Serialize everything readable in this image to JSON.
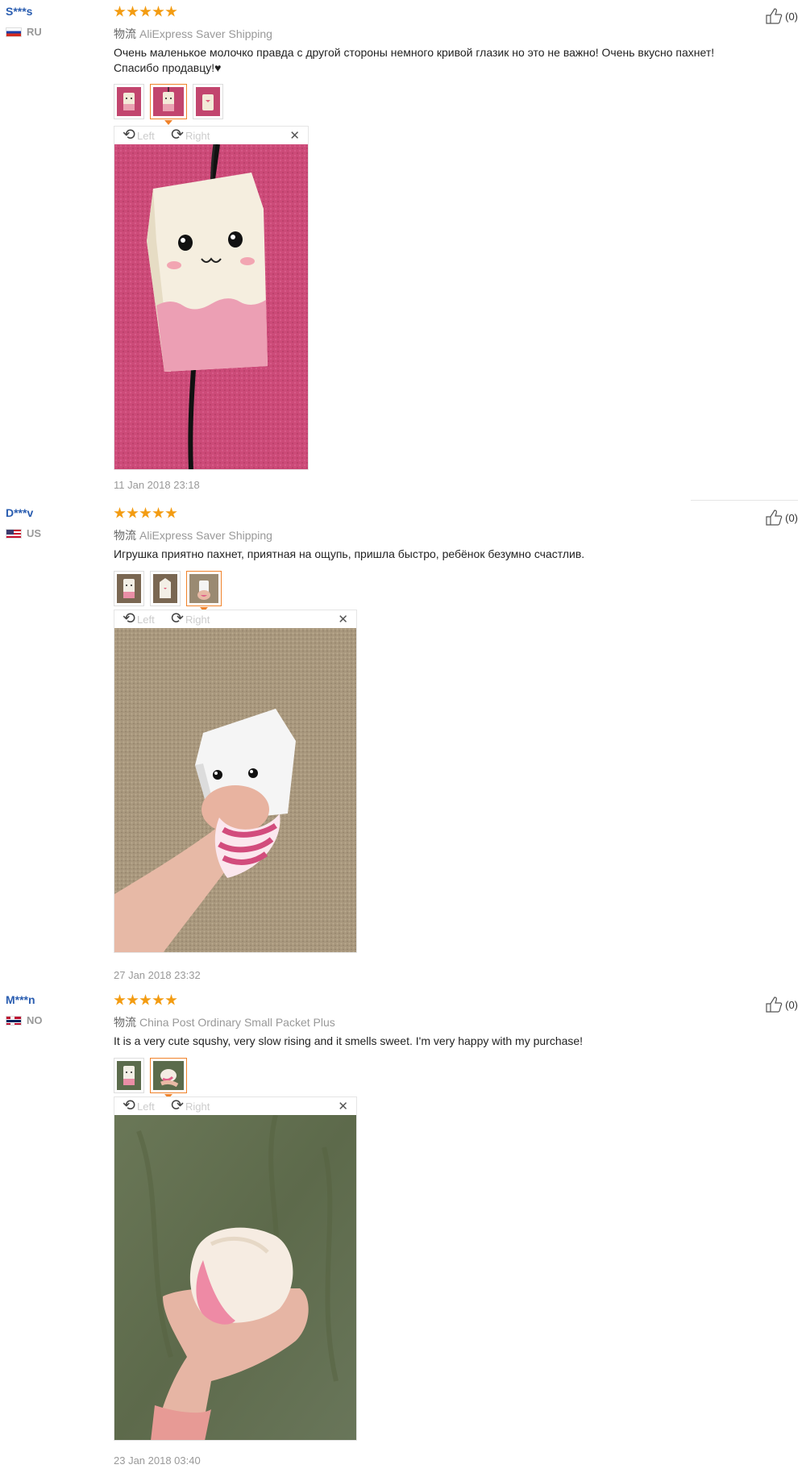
{
  "reviews": [
    {
      "user": "S***s",
      "country": "RU",
      "shipping_label": "物流",
      "shipping": "AliExpress Saver Shipping",
      "text_lines": [
        "Очень маленькое молочко правда с другой стороны немного кривой глазик но это не важно! Очень вкусно пахнет!",
        "Спасибо продавцу!♥"
      ],
      "rotate_left": "Left",
      "rotate_right": "Right",
      "date": "11 Jan 2018 23:18",
      "helpful": "(0)",
      "rating": 5
    },
    {
      "user": "D***v",
      "country": "US",
      "shipping_label": "物流",
      "shipping": "AliExpress Saver Shipping",
      "text_lines": [
        "Игрушка приятно пахнет, приятная на ощупь, пришла быстро, ребёнок безумно счастлив."
      ],
      "rotate_left": "Left",
      "rotate_right": "Right",
      "date": "27 Jan 2018 23:32",
      "helpful": "(0)",
      "rating": 5
    },
    {
      "user": "M***n",
      "country": "NO",
      "shipping_label": "物流",
      "shipping": "China Post Ordinary Small Packet Plus",
      "text_lines": [
        "It is a very cute squshy, very slow rising and it smells sweet. I'm very happy with my purchase!"
      ],
      "rotate_left": "Left",
      "rotate_right": "Right",
      "date": "23 Jan 2018 03:40",
      "helpful": "(0)",
      "rating": 5
    }
  ],
  "colors": {
    "accent": "#f0832b",
    "username": "#2a5db0",
    "star": "#f39c12"
  }
}
